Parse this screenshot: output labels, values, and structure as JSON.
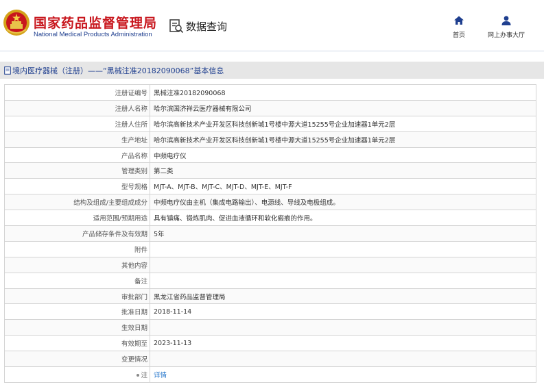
{
  "header": {
    "title": "国家药品监督管理局",
    "subtitle": "National Medical Products Administration",
    "query_label": "数据查询",
    "nav": [
      {
        "label": "首页",
        "icon": "home-icon"
      },
      {
        "label": "网上办事大厅",
        "icon": "user-icon"
      }
    ],
    "colors": {
      "brand_red": "#c8161d",
      "brand_blue": "#1f3f8f"
    }
  },
  "breadcrumb": "境内医疗器械（注册）——“黑械注准20182090068”基本信息",
  "rows": [
    {
      "label": "注册证编号",
      "value": "黑械注准20182090068"
    },
    {
      "label": "注册人名称",
      "value": "哈尔滨国济祥云医疗器械有限公司"
    },
    {
      "label": "注册人住所",
      "value": "哈尔滨高新技术产业开发区科技创新城1号楼中源大道15255号企业加速器1单元2层"
    },
    {
      "label": "生产地址",
      "value": "哈尔滨高新技术产业开发区科技创新城1号楼中源大道15255号企业加速器1单元2层"
    },
    {
      "label": "产品名称",
      "value": "中频电疗仪"
    },
    {
      "label": "管理类别",
      "value": "第二类"
    },
    {
      "label": "型号规格",
      "value": "MJT-A、MJT-B、MJT-C、MJT-D、MJT-E、MJT-F"
    },
    {
      "label": "结构及组成/主要组成成分",
      "value": "中频电疗仪由主机（集成电路输出）、电源线、导线及电极组成。"
    },
    {
      "label": "适用范围/预期用途",
      "value": "具有镇痛、锻炼肌肉、促进血液循环和软化瘢痕的作用。"
    },
    {
      "label": "产品储存条件及有效期",
      "value": "5年"
    },
    {
      "label": "附件",
      "value": ""
    },
    {
      "label": "其他内容",
      "value": ""
    },
    {
      "label": "备注",
      "value": ""
    },
    {
      "label": "审批部门",
      "value": "黑龙江省药品监督管理局"
    },
    {
      "label": "批准日期",
      "value": "2018-11-14"
    },
    {
      "label": "生效日期",
      "value": ""
    },
    {
      "label": "有效期至",
      "value": "2023-11-13"
    },
    {
      "label": "变更情况",
      "value": ""
    },
    {
      "label": "注",
      "value": "详情"
    }
  ]
}
